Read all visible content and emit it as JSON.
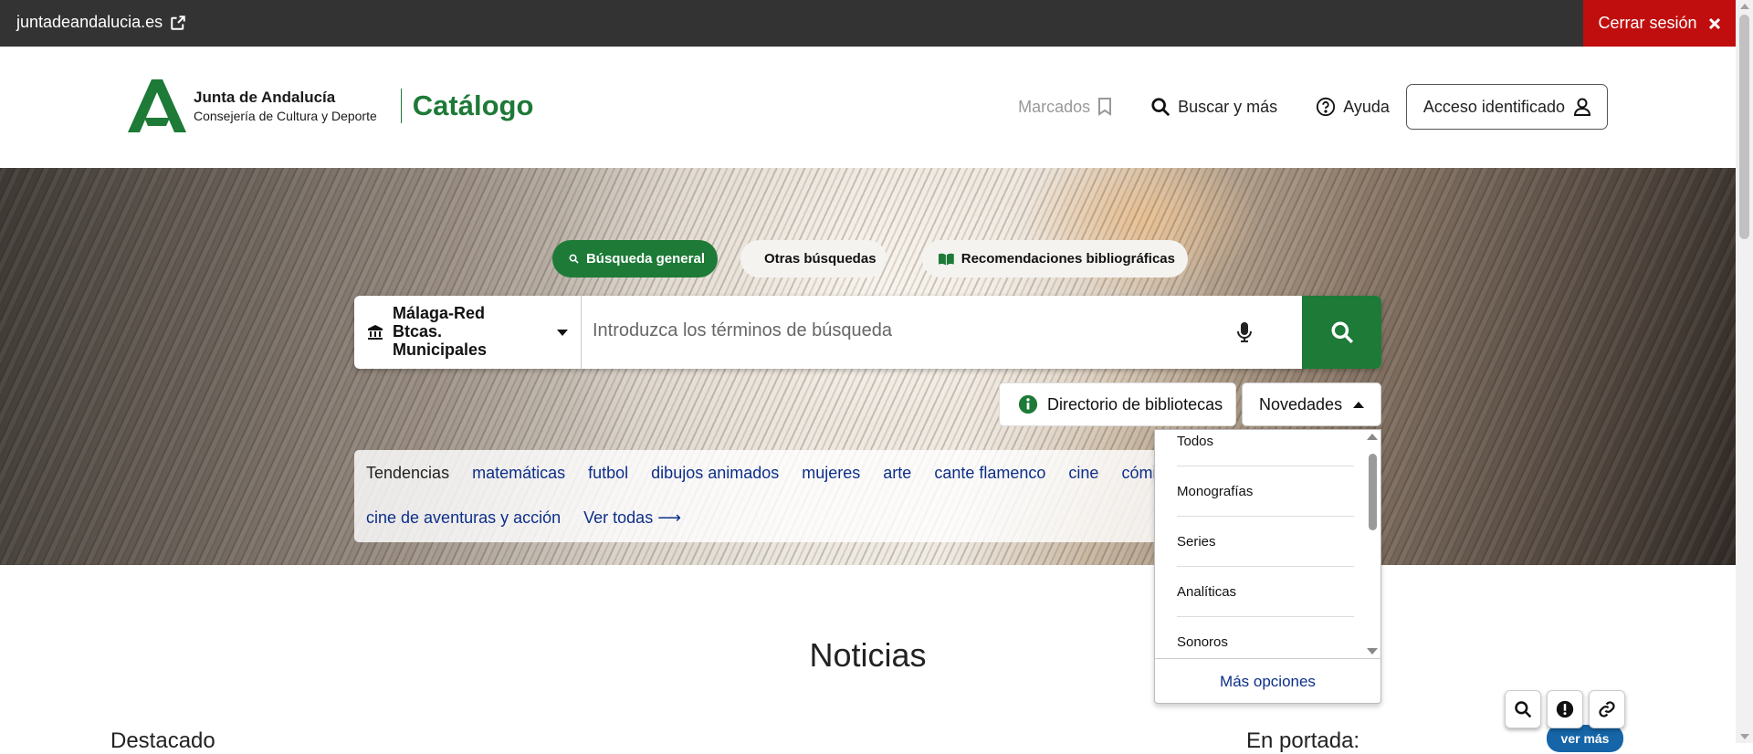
{
  "topbar": {
    "site_link": "juntadeandalucia.es",
    "logout": "Cerrar sesión"
  },
  "header": {
    "org_line1": "Junta de Andalucía",
    "org_line2": "Consejería de Cultura y Deporte",
    "catalog": "Catálogo",
    "nav": {
      "marked": "Marcados",
      "search_more": "Buscar y más",
      "help": "Ayuda",
      "login": "Acceso identificado"
    }
  },
  "search": {
    "tabs": [
      {
        "label": "Búsqueda general",
        "icon": "search-icon",
        "active": true
      },
      {
        "label": "Otras búsquedas",
        "icon": "zoom-plus-icon",
        "active": false
      },
      {
        "label": "Recomendaciones bibliográficas",
        "icon": "book-open-icon",
        "active": false
      }
    ],
    "library": "Málaga-Red Btcas. Municipales",
    "placeholder": "Introduzca los términos de búsqueda",
    "directory_btn": "Directorio de bibliotecas",
    "novedades_btn": "Novedades"
  },
  "trends": {
    "label": "Tendencias",
    "tags": [
      "matemáticas",
      "futbol",
      "dibujos animados",
      "mujeres",
      "arte",
      "cante flamenco",
      "cine",
      "cómi"
    ],
    "tags_row2": [
      "cine de aventuras y acción"
    ],
    "see_all": "Ver todas ⟶"
  },
  "dropdown": {
    "options": [
      "Todos",
      "Monografías",
      "Series",
      "Analíticas",
      "Sonoros"
    ],
    "more": "Más opciones"
  },
  "news": {
    "title": "Noticias",
    "featured": "Destacado",
    "front_page": "En portada:",
    "see_more": "ver más"
  },
  "colors": {
    "brand_green": "#1d7a37",
    "topbar": "#333333",
    "logout_red": "#c00e0e",
    "link_blue": "#0d2f8a"
  }
}
